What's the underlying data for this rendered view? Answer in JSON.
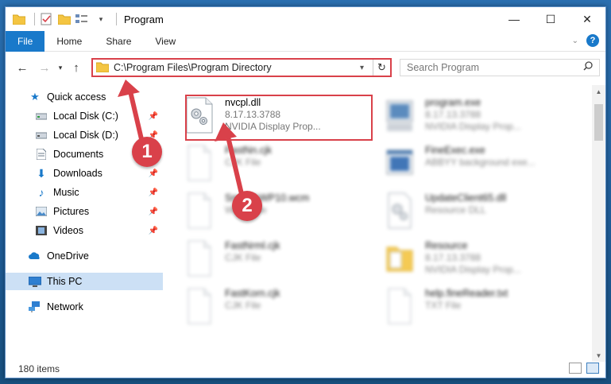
{
  "window": {
    "title": "Program",
    "minimize": "—",
    "maximize": "☐",
    "close": "✕"
  },
  "ribbon": {
    "tabs": [
      "File",
      "Home",
      "Share",
      "View"
    ]
  },
  "nav": {
    "back": "←",
    "forward": "→",
    "recent": "▾",
    "up": "↑",
    "address_path": "C:\\Program Files\\Program Directory",
    "search_placeholder": "Search Program"
  },
  "sidebar": {
    "items": [
      {
        "label": "Quick access",
        "icon": "star-icon"
      },
      {
        "label": "Local Disk (C:)",
        "icon": "drive-icon",
        "pinned": true
      },
      {
        "label": "Local Disk (D:)",
        "icon": "drive-icon",
        "pinned": true
      },
      {
        "label": "Documents",
        "icon": "document-icon",
        "pinned": true
      },
      {
        "label": "Downloads",
        "icon": "download-icon",
        "pinned": true
      },
      {
        "label": "Music",
        "icon": "music-icon",
        "pinned": true
      },
      {
        "label": "Pictures",
        "icon": "picture-icon",
        "pinned": true
      },
      {
        "label": "Videos",
        "icon": "video-icon",
        "pinned": true
      },
      {
        "label": "OneDrive",
        "icon": "cloud-icon"
      },
      {
        "label": "This PC",
        "icon": "computer-icon",
        "selected": true
      },
      {
        "label": "Network",
        "icon": "network-icon"
      }
    ]
  },
  "files": [
    {
      "name": "nvcpl.dll",
      "line2": "8.17.13.3788",
      "line3": "NVIDIA Display Prop...",
      "highlighted": true
    },
    {
      "name": "program.exe",
      "line2": "8.17.13.3788",
      "line3": "NVIDIA Display Prop..."
    },
    {
      "name": "FastNn.cjk",
      "line2": "CJK File",
      "line3": ""
    },
    {
      "name": "FineExec.exe",
      "line2": "ABBYY background exe...",
      "line3": ""
    },
    {
      "name": "SmoothWP10.wcm",
      "line2": "WCM File",
      "line3": ""
    },
    {
      "name": "UpdateClient65.dll",
      "line2": "Resource DLL",
      "line3": ""
    },
    {
      "name": "FastNrml.cjk",
      "line2": "CJK File",
      "line3": ""
    },
    {
      "name": "Resource",
      "line2": "8.17.13.3788",
      "line3": "NVIDIA Display Prop..."
    },
    {
      "name": "FastKorn.cjk",
      "line2": "CJK File",
      "line3": ""
    },
    {
      "name": "help.fineReader.txt",
      "line2": "TXT File",
      "line3": ""
    }
  ],
  "status": {
    "item_count": "180 items"
  },
  "callouts": {
    "one": "1",
    "two": "2"
  },
  "colors": {
    "accent": "#1979ca",
    "highlight": "#d9414a",
    "selected_bg": "#cce0f5"
  }
}
